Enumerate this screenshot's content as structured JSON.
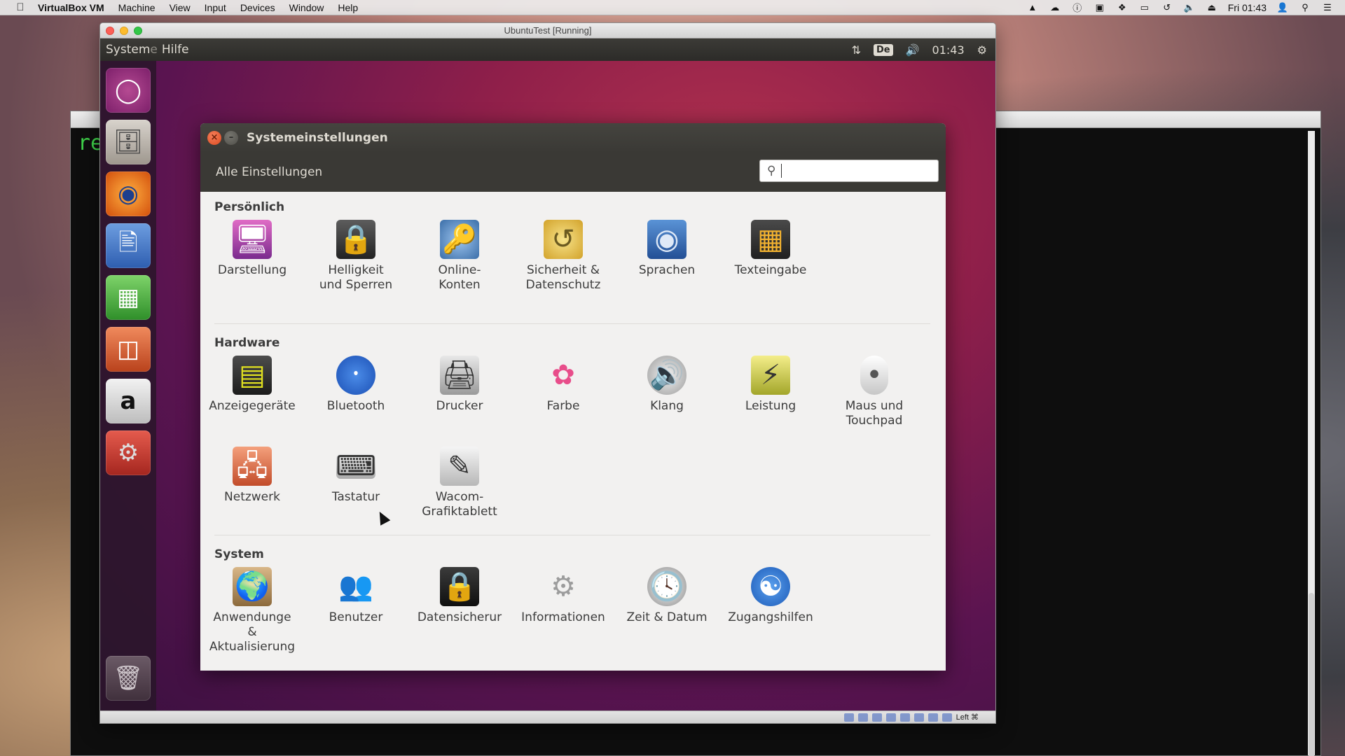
{
  "menubar": {
    "app": "VirtualBox VM",
    "menus": [
      "Machine",
      "View",
      "Input",
      "Devices",
      "Window",
      "Help"
    ],
    "clock": "Fri 01:43"
  },
  "vbox": {
    "title": "UbuntuTest [Running]",
    "status_text": "Left ⌘"
  },
  "bg_terminal": {
    "prompt": "re"
  },
  "ubuntu_panel": {
    "app_title_visible": "System",
    "app_title_fade": "e",
    "menu_help": "Hilfe",
    "keyboard_layout": "De",
    "clock": "01:43"
  },
  "settings": {
    "title": "Systemeinstellungen",
    "all_settings": "Alle Einstellungen",
    "search_value": "",
    "sections": {
      "personal": "Persönlich",
      "hardware": "Hardware",
      "system": "System"
    },
    "personal_items": [
      {
        "label": "Darstellung",
        "icon": "display-appearance-icon"
      },
      {
        "label": "Helligkeit\nund Sperren",
        "icon": "brightness-lock-icon"
      },
      {
        "label": "Online-\nKonten",
        "icon": "online-accounts-icon"
      },
      {
        "label": "Sicherheit &\nDatenschutz",
        "icon": "privacy-icon"
      },
      {
        "label": "Sprachen",
        "icon": "language-icon"
      },
      {
        "label": "Texteingabe",
        "icon": "text-entry-icon"
      }
    ],
    "hardware_items": [
      {
        "label": "Anzeigegeräte",
        "icon": "displays-icon"
      },
      {
        "label": "Bluetooth",
        "icon": "bluetooth-icon"
      },
      {
        "label": "Drucker",
        "icon": "printer-icon"
      },
      {
        "label": "Farbe",
        "icon": "color-icon"
      },
      {
        "label": "Klang",
        "icon": "sound-icon"
      },
      {
        "label": "Leistung",
        "icon": "power-icon"
      },
      {
        "label": "Maus und\nTouchpad",
        "icon": "mouse-icon"
      },
      {
        "label": "Netzwerk",
        "icon": "network-icon"
      },
      {
        "label": "Tastatur",
        "icon": "keyboard-icon"
      },
      {
        "label": "Wacom-\nGrafiktablett",
        "icon": "wacom-tablet-icon"
      }
    ],
    "system_items": [
      {
        "label": "Anwendunge\n&\nAktualisierung",
        "icon": "software-updates-icon"
      },
      {
        "label": "Benutzer",
        "icon": "users-icon"
      },
      {
        "label": "Datensicherur",
        "icon": "backup-icon"
      },
      {
        "label": "Informationen",
        "icon": "details-gear-icon"
      },
      {
        "label": "Zeit & Datum",
        "icon": "clock-icon"
      },
      {
        "label": "Zugangshilfen",
        "icon": "accessibility-icon"
      }
    ]
  },
  "launcher": [
    {
      "name": "ubuntu-dash-icon"
    },
    {
      "name": "files-icon"
    },
    {
      "name": "firefox-icon"
    },
    {
      "name": "writer-icon"
    },
    {
      "name": "calc-icon"
    },
    {
      "name": "impress-icon"
    },
    {
      "name": "amazon-icon"
    },
    {
      "name": "system-settings-icon"
    },
    {
      "name": "trash-icon"
    }
  ]
}
